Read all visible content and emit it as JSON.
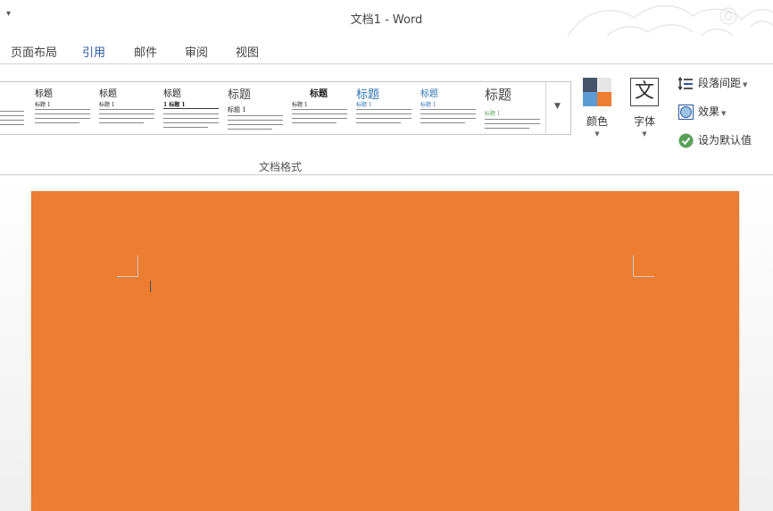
{
  "window": {
    "title": "文档1 - Word"
  },
  "tabs": [
    "页面布局",
    "引用",
    "邮件",
    "审阅",
    "视图"
  ],
  "active_tab": "引用",
  "gallery": {
    "group_label": "文档格式",
    "items": [
      {
        "title": "",
        "sub": ""
      },
      {
        "title": "标题",
        "sub": "标题 1"
      },
      {
        "title": "标题",
        "sub": "标题 1"
      },
      {
        "title": "标题",
        "sub": "1  标题 1"
      },
      {
        "title": "标题",
        "sub": "标题 1"
      },
      {
        "title": "标题",
        "sub": "标题 1"
      },
      {
        "title": "标题",
        "sub": "标题 1"
      },
      {
        "title": "标题",
        "sub": "标题 1"
      },
      {
        "title": "标题",
        "sub": "标题 1"
      }
    ]
  },
  "design": {
    "colors_label": "颜色",
    "fonts_label": "字体",
    "fonts_glyph": "文",
    "paragraph_spacing_label": "段落间距",
    "effects_label": "效果",
    "set_default_label": "设为默认值"
  },
  "colors": {
    "accent": "#2b579a",
    "page_background": "#ed7d31",
    "swatch": [
      "#44546a",
      "#e7e6e6",
      "#5b9bd5",
      "#ed7d31"
    ],
    "check_green": "#5ba05a"
  },
  "icons": {
    "qat": "chevron-down-icon",
    "gallery_more": "chevron-down-icon",
    "colors": "color-palette-icon",
    "fonts": "font-glyph-icon",
    "paragraph_spacing": "paragraph-spacing-icon",
    "effects": "effects-icon",
    "set_default": "checkmark-icon"
  }
}
